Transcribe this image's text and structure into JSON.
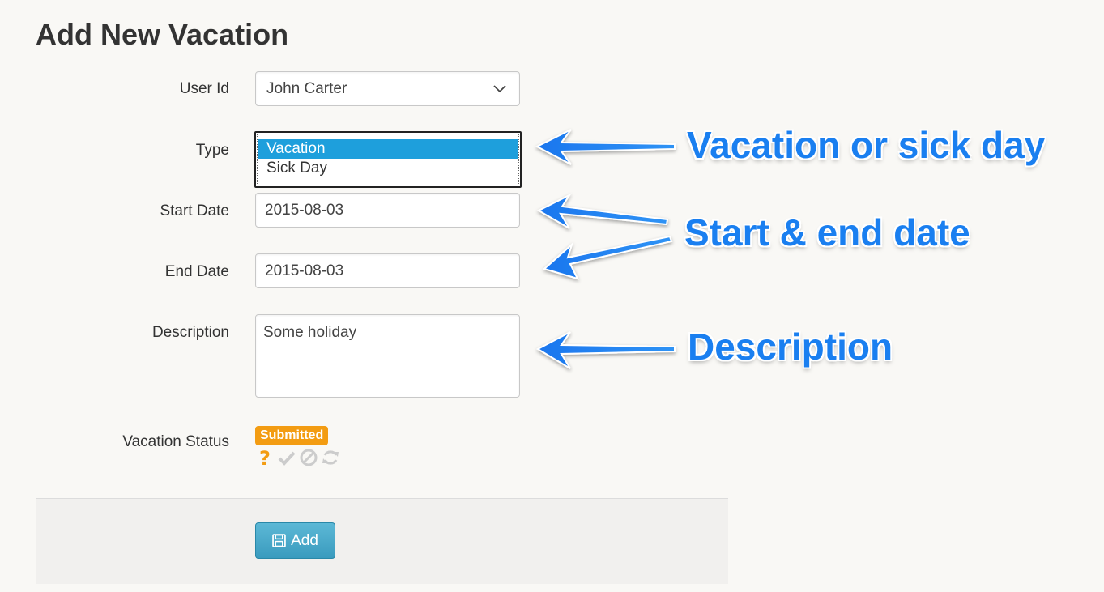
{
  "page": {
    "title": "Add New Vacation"
  },
  "form": {
    "user_id": {
      "label": "User Id",
      "value": "John Carter"
    },
    "type": {
      "label": "Type",
      "options": [
        "Vacation",
        "Sick Day"
      ],
      "selected": "Vacation"
    },
    "start_date": {
      "label": "Start Date",
      "value": "2015-08-03"
    },
    "end_date": {
      "label": "End Date",
      "value": "2015-08-03"
    },
    "description": {
      "label": "Description",
      "value": "Some holiday"
    },
    "status": {
      "label": "Vacation Status",
      "badge": "Submitted",
      "badge_color": "#f39c12",
      "icons": [
        "question-icon",
        "check-icon",
        "ban-icon",
        "refresh-icon"
      ]
    }
  },
  "footer": {
    "add_label": "Add"
  },
  "annotations": {
    "type_note": "Vacation or sick day",
    "dates_note": "Start & end date",
    "description_note": "Description"
  },
  "colors": {
    "accent": "#1e9fdc",
    "annotation": "#1a7ff0",
    "button": "#3a9bbe"
  }
}
